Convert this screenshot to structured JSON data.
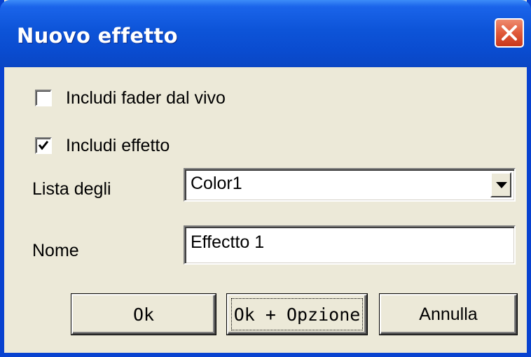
{
  "window": {
    "title": "Nuovo effetto",
    "titlebar_color": "#0a4cd0",
    "close_icon": "close-icon"
  },
  "options": {
    "include_live_fader": {
      "label": "Includi fader dal vivo",
      "checked": false
    },
    "include_effect": {
      "label": "Includi effetto",
      "checked": true
    }
  },
  "list": {
    "label": "Lista degli",
    "selected": "Color1"
  },
  "name": {
    "label": "Nome",
    "value": "Effectto 1"
  },
  "buttons": {
    "ok": "Ok",
    "ok_option": "Ok + Opzione",
    "cancel": "Annulla"
  }
}
